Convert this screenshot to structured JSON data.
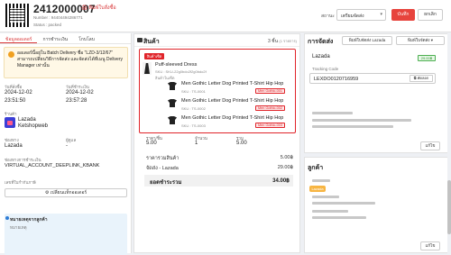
{
  "header": {
    "order_number": "2412000007",
    "print_link": "พิมพ์ใบสั่งซื้อ",
    "number_label": "Number : 94404494286771",
    "status_line": "Status : packed",
    "status_label": "สถานะ",
    "status_value": "เตรียมจัดส่ง",
    "save_label": "บันทึก",
    "cancel_label": "ยกเลิก"
  },
  "left_panel": {
    "tabs": [
      {
        "label": "ข้อมูลออเดอร์",
        "active": true
      },
      {
        "label": "การชำระเงิน",
        "active": false
      },
      {
        "label": "โกบโลบ",
        "active": false
      }
    ],
    "notice": "ออเดอร์นี้อยู่ใน Batch Delivery ชื่อ \"LZD-3/12/67\" สามารถเปลี่ยนวิธีการจัดส่ง และจัดส่งได้ที่เมนู Delivery Manager เท่านั้น",
    "created_label": "วันที่สั่งซื้อ",
    "created_date": "2024-12-02",
    "created_time": "23:51:50",
    "paid_label": "วันที่ชำระเงิน",
    "paid_date": "2024-12-02",
    "paid_time": "23:57:28",
    "shop_label": "ร้านค้า",
    "shop_name": "Lazada",
    "shop_account": "Ketshopweb",
    "channel_label": "ช่องทาง",
    "channel_value": "Lazada",
    "channel2_label": "ผู้ดูแล",
    "channel2_value": "-",
    "payment_label": "ช่องทางการชำระเงิน",
    "payment_value": "VIRTUAL_ACCOUNT_DEEPLINK_KBANK",
    "tax_label": "เลขที่ใบกำกับภาษี",
    "tax_button": "เปลี่ยนแท็กออเดอร์",
    "notes_title": "หมายเหตุจากลูกค้า",
    "notes_sub": "หมายเหตุ"
  },
  "products": {
    "title": "สินค้า",
    "count_label": "3 ชิ้น",
    "count_sub": "(1 รายการ)",
    "bundle_badge": "สินค้าเซ็ต",
    "bundle_name": "Puff-sleeved Dress",
    "bundle_sku": "SKU : SKU-22g0bdo2f2g0bdo2f",
    "bundle_sub": "สินค้าในเซ็ต",
    "items": [
      {
        "name": "Men Gothic Letter Dog Printed T-Shirt Hip Hop",
        "sku": "SKU : TS-0001",
        "tag": "Men Gothic-001"
      },
      {
        "name": "Men Gothic Letter Dog Printed T-Shirt Hip Hop",
        "sku": "SKU : TS-0002",
        "tag": "Men Gothic-002"
      },
      {
        "name": "Men Gothic Letter Dog Printed T-Shirt Hip Hop",
        "sku": "SKU : TS-0003",
        "tag": "Men Gothic-003"
      }
    ],
    "callout": "7",
    "price_label": "ราคา/ชิ้น",
    "price_value": "5.00",
    "qty_label": "จำนวน",
    "qty_value": "1",
    "line_total_label": "รวม",
    "line_total_value": "5.00",
    "subtotal_label": "ราคารวมสินค้า",
    "subtotal_value": "5.00฿",
    "shipping_label": "จัดส่ง - Lazada",
    "shipping_value": "29.00฿",
    "grand_label": "ยอดชำระรวม",
    "grand_value": "34.00฿"
  },
  "shipping": {
    "title": "การจัดส่ง",
    "print_label_button": "พิมพ์ใบจัดส่ง Lazada",
    "print_menu_button": "พิมพ์ใบจัดส่ง",
    "carrier": "Lazada",
    "weight_badge": "29.00฿",
    "tracking_label": "Tracking Code",
    "tracking_value": "LEXDO0120716959",
    "copy_button": "คัดลอก",
    "edit_button": "แก้ไข"
  },
  "customer": {
    "title": "ลูกค้า",
    "tag": "Lazada",
    "edit_button": "แก้ไข"
  }
}
